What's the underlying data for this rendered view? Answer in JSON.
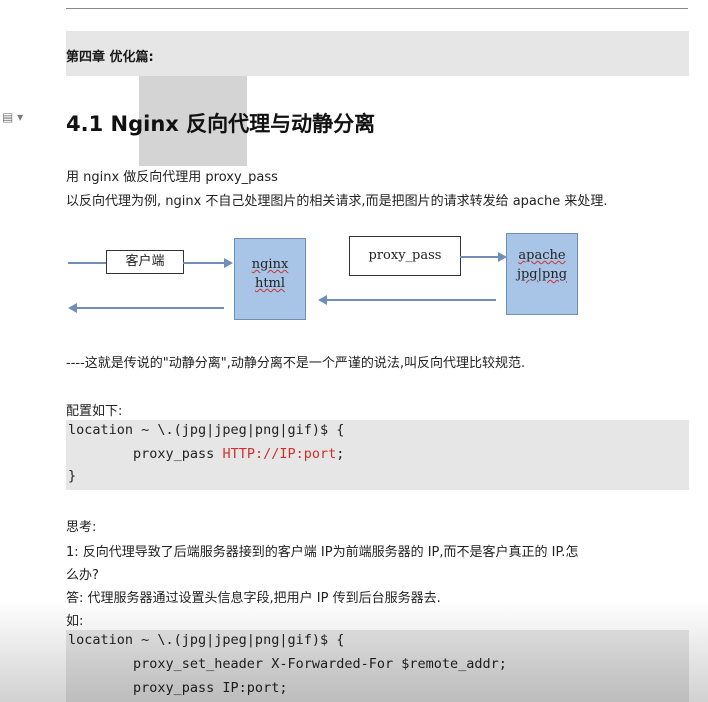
{
  "chapter": "第四章  优化篇:",
  "heading": "4.1 Nginx 反向代理与动静分离",
  "intro": {
    "line1": "用 nginx 做反向代理用 proxy_pass",
    "line2": "以反向代理为例, nginx 不自己处理图片的相关请求,而是把图片的请求转发给 apache 来处理."
  },
  "diagram": {
    "client": "客户端",
    "nginx_line1": "nginx",
    "nginx_line2": "html",
    "proxy_pass": "proxy_pass",
    "apache_line1": "apache",
    "apache_line2": "jpg|png"
  },
  "note": "----这就是传说的\"动静分离\",动静分离不是一个严谨的说法,叫反向代理比较规范.",
  "config_label": "配置如下:",
  "code1": {
    "line1": "location ~ \\.(jpg|jpeg|png|gif)$ {",
    "line2_prefix": "        proxy_pass ",
    "line2_value": "HTTP://IP:port",
    "line2_suffix": ";",
    "line3": "}"
  },
  "think": {
    "title": "思考:",
    "q_line1": "1: 反向代理导致了后端服务器接到的客户端 IP为前端服务器的 IP,而不是客户真正的 IP.怎",
    "q_line2": "么办?",
    "answer": "答: 代理服务器通过设置头信息字段,把用户 IP 传到后台服务器去.",
    "example": "如:"
  },
  "code2": {
    "line1": "location ~ \\.(jpg|jpeg|png|gif)$ {",
    "line2": "        proxy_set_header X-Forwarded-For $remote_addr;",
    "line3": "        proxy_pass IP:port;"
  },
  "colors": {
    "box_blue": "#a8c4e6",
    "arrow": "#6f8fb8",
    "code_bg": "#e6e6e6",
    "code_red": "#d0312d"
  }
}
